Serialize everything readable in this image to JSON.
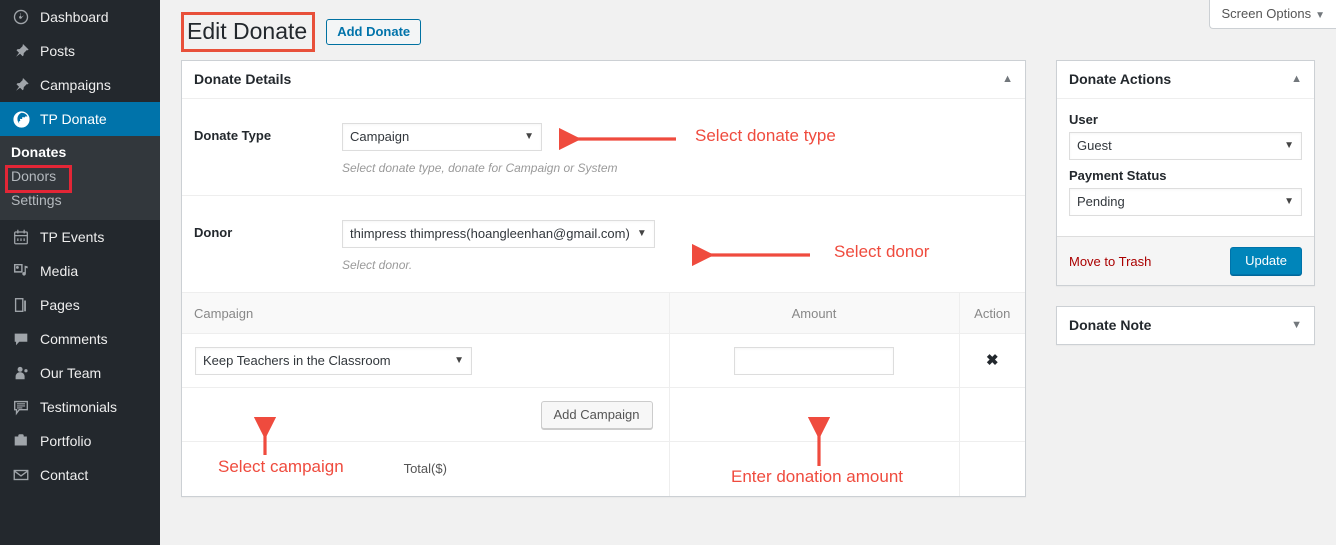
{
  "sidebar": {
    "items": [
      {
        "label": "Dashboard",
        "icon": "dashboard-icon"
      },
      {
        "label": "Posts",
        "icon": "pin-icon"
      },
      {
        "label": "Campaigns",
        "icon": "pin-icon"
      },
      {
        "label": "TP Donate",
        "icon": "globe-icon",
        "active": true
      },
      {
        "label": "TP Events",
        "icon": "calendar-icon"
      },
      {
        "label": "Media",
        "icon": "media-icon"
      },
      {
        "label": "Pages",
        "icon": "pages-icon"
      },
      {
        "label": "Comments",
        "icon": "comment-icon"
      },
      {
        "label": "Our Team",
        "icon": "user-icon"
      },
      {
        "label": "Testimonials",
        "icon": "testimonial-icon"
      },
      {
        "label": "Portfolio",
        "icon": "portfolio-icon"
      },
      {
        "label": "Contact",
        "icon": "envelope-icon"
      }
    ],
    "submenu": [
      {
        "label": "Donates",
        "current": true
      },
      {
        "label": "Donors",
        "current": false
      },
      {
        "label": "Settings",
        "current": false
      }
    ]
  },
  "header": {
    "screen_options": "Screen Options",
    "screen_options_caret": "▼",
    "page_title": "Edit Donate",
    "add_button": "Add Donate"
  },
  "main": {
    "panel_title": "Donate Details",
    "panel_toggle": "▲",
    "donate_type": {
      "label": "Donate Type",
      "value": "Campaign",
      "caret": "▼",
      "description": "Select donate type, donate for Campaign or System"
    },
    "donor": {
      "label": "Donor",
      "value": "thimpress thimpress(hoangleenhan@gmail.com)",
      "caret": "▼",
      "description": "Select donor."
    },
    "table": {
      "columns": [
        "Campaign",
        "Amount",
        "Action"
      ],
      "rows": [
        {
          "campaign": "Keep Teachers in the Classroom",
          "caret": "▼",
          "amount": "",
          "amount_placeholder": "",
          "action": "✖"
        }
      ],
      "add_button": "Add Campaign",
      "total_label": "Total($)",
      "total_value": ""
    }
  },
  "side": {
    "actions_title": "Donate Actions",
    "actions_toggle": "▲",
    "user_label": "User",
    "user_value": "Guest",
    "user_caret": "▼",
    "payment_label": "Payment Status",
    "payment_value": "Pending",
    "payment_caret": "▼",
    "trash_label": "Move to Trash",
    "update_label": "Update",
    "note_title": "Donate Note",
    "note_toggle": "▼"
  },
  "annotations": {
    "donate_type": "Select donate type",
    "donor": "Select donor",
    "campaign": "Select campaign",
    "amount": "Enter donation amount"
  },
  "colors": {
    "accent": "#0073aa",
    "sidebar_bg": "#23282d",
    "submenu_bg": "#32373c",
    "annotation": "#ef4b3e",
    "highlight_box": "#e32636",
    "button_primary": "#0085ba",
    "trash_link": "#aa0000"
  }
}
